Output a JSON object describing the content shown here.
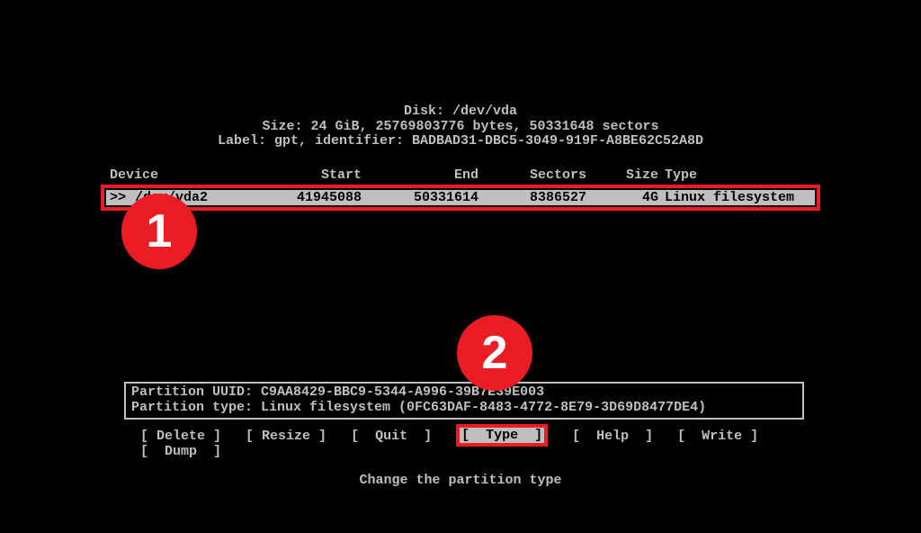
{
  "disk": {
    "title": "Disk: /dev/vda",
    "size": "Size: 24 GiB, 25769803776 bytes, 50331648 sectors",
    "label": "Label: gpt, identifier: BADBAD31-DBC5-3049-919F-A8BE62C52A8D"
  },
  "headers": {
    "device": "Device",
    "start": "Start",
    "end": "End",
    "sectors": "Sectors",
    "size": "Size",
    "type": "Type"
  },
  "selected_row": {
    "pointer": ">>",
    "device": "/dev/vda2",
    "start": "41945088",
    "end": "50331614",
    "sectors": "8386527",
    "size": "4G",
    "type": "Linux filesystem"
  },
  "info": {
    "uuid": "Partition UUID: C9AA8429-BBC9-5344-A996-39B7E39E003",
    "ptype": "Partition type: Linux filesystem (0FC63DAF-8483-4772-8E79-3D69D8477DE4)"
  },
  "menu": {
    "delete": "[ Delete ]",
    "resize": "[ Resize ]",
    "quit": "[  Quit  ]",
    "type": "[  Type  ]",
    "help": "[  Help  ]",
    "write": "[  Write ]",
    "dump": "[  Dump  ]"
  },
  "hint": "Change the partition type",
  "annotations": {
    "b1": "1",
    "b2": "2"
  }
}
